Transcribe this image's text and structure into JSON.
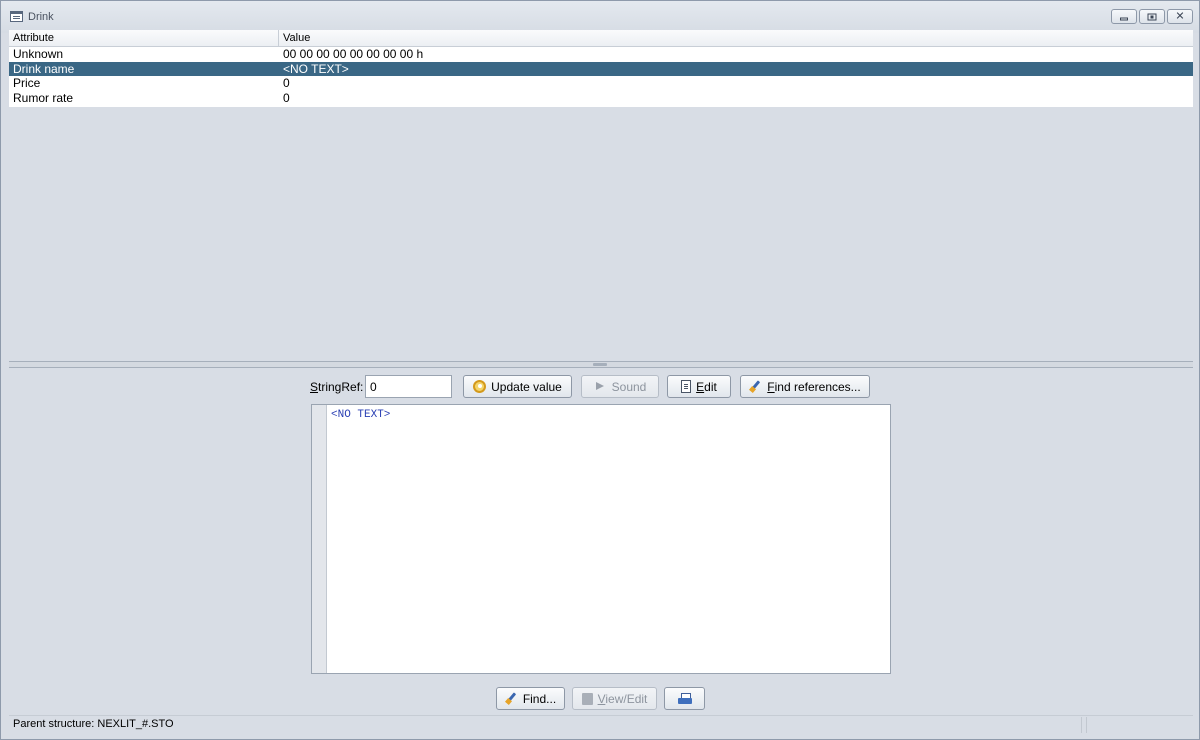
{
  "window": {
    "title": "Drink"
  },
  "table": {
    "headers": {
      "attribute": "Attribute",
      "value": "Value"
    },
    "rows": [
      {
        "attribute": "Unknown",
        "value": "00 00 00 00 00 00 00 00 h"
      },
      {
        "attribute": "Drink name",
        "value": "<NO TEXT>"
      },
      {
        "attribute": "Price",
        "value": "0"
      },
      {
        "attribute": "Rumor rate",
        "value": "0"
      }
    ],
    "selected_index": 1
  },
  "stringref": {
    "label": "StringRef:",
    "value": "0",
    "buttons": {
      "update": "Update value",
      "sound": "Sound",
      "edit": "Edit",
      "find_refs": "Find references..."
    }
  },
  "editor": {
    "text": "<NO TEXT>"
  },
  "bottom_buttons": {
    "find": "Find...",
    "view_edit": "View/Edit"
  },
  "status": {
    "text": "Parent structure: NEXLIT_#.STO"
  }
}
